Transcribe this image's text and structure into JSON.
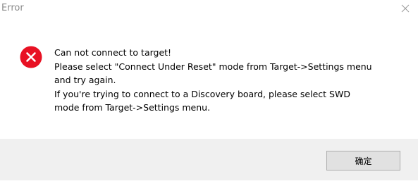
{
  "window": {
    "title": "Error",
    "close_icon": "close-icon"
  },
  "message": {
    "icon": "error-icon",
    "icon_color": "#e81123",
    "lines": [
      "Can not connect to target!",
      "Please select \"Connect Under Reset\" mode from Target->Settings menu",
      "and try again.",
      "If you're trying to connect to a Discovery board, please select SWD",
      "mode from Target->Settings menu."
    ]
  },
  "footer": {
    "ok_label": "确定"
  }
}
